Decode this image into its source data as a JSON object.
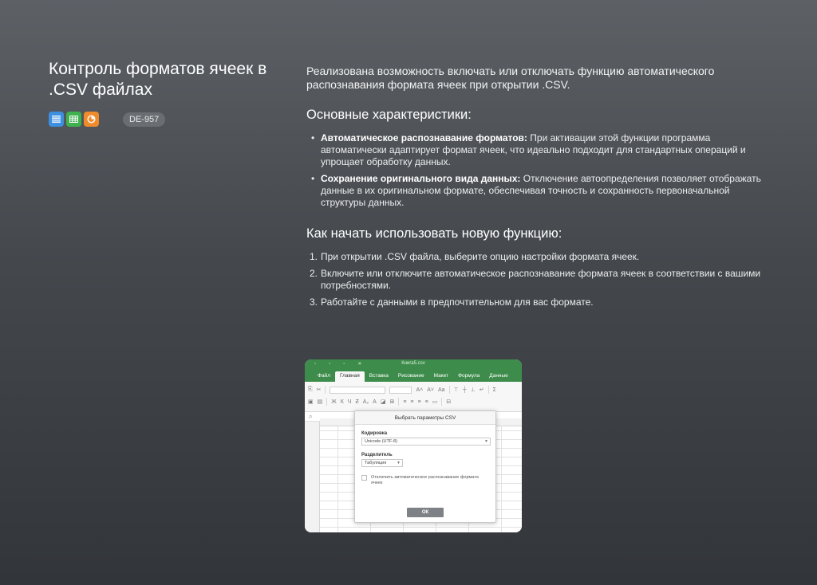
{
  "header": {
    "title": "Контроль форматов ячеек в .CSV файлах",
    "issue_id": "DE-957",
    "app_icons": [
      "document-icon",
      "spreadsheet-icon",
      "presentation-icon"
    ],
    "app_colors": {
      "document": "#3d8fe0",
      "spreadsheet": "#3fb14e",
      "presentation": "#f08b2c"
    }
  },
  "content": {
    "intro": "Реализована возможность включать или отключать функцию автоматического распознавания формата ячеек при открытии .CSV.",
    "features_heading": "Основные характеристики:",
    "features": [
      {
        "title": "Автоматическое распознавание форматов:",
        "text": " При активации этой функции программа автоматически адаптирует формат ячеек, что идеально подходит для стандартных операций и упрощает обработку данных."
      },
      {
        "title": "Сохранение оригинального вида данных:",
        "text": " Отключение автоопределения позволяет отображать данные в их оригинальном формате, обеспечивая точность и сохранность первоначальной структуры данных."
      }
    ],
    "howto_heading": "Как начать использовать новую функцию:",
    "steps": [
      {
        "num": "1.",
        "text": "При открытии .CSV файла, выберите опцию настройки формата ячеек."
      },
      {
        "num": "2.",
        "text": "Включите или отключите автоматическое распознавание формата ячеек в соответствии с вашими потребностями."
      },
      {
        "num": "3.",
        "text": "Работайте с данными в предпочтительном для вас формате."
      }
    ]
  },
  "screenshot": {
    "window_title": "Книга5.csv",
    "tabs": [
      "Файл",
      "Главная",
      "Вставка",
      "Рисование",
      "Макет",
      "Формула",
      "Данные"
    ],
    "active_tab": "Главная",
    "accent_color": "#3d8c4b",
    "dialog": {
      "title": "Выбрать параметры CSV",
      "encoding_label": "Кодировка",
      "encoding_value": "Unicode (UTF-8)",
      "delimiter_label": "Разделитель",
      "delimiter_value": "Табуляция",
      "checkbox_label": "Отключить автоматическое распознавание формата ячеек",
      "ok_label": "ОК"
    }
  }
}
